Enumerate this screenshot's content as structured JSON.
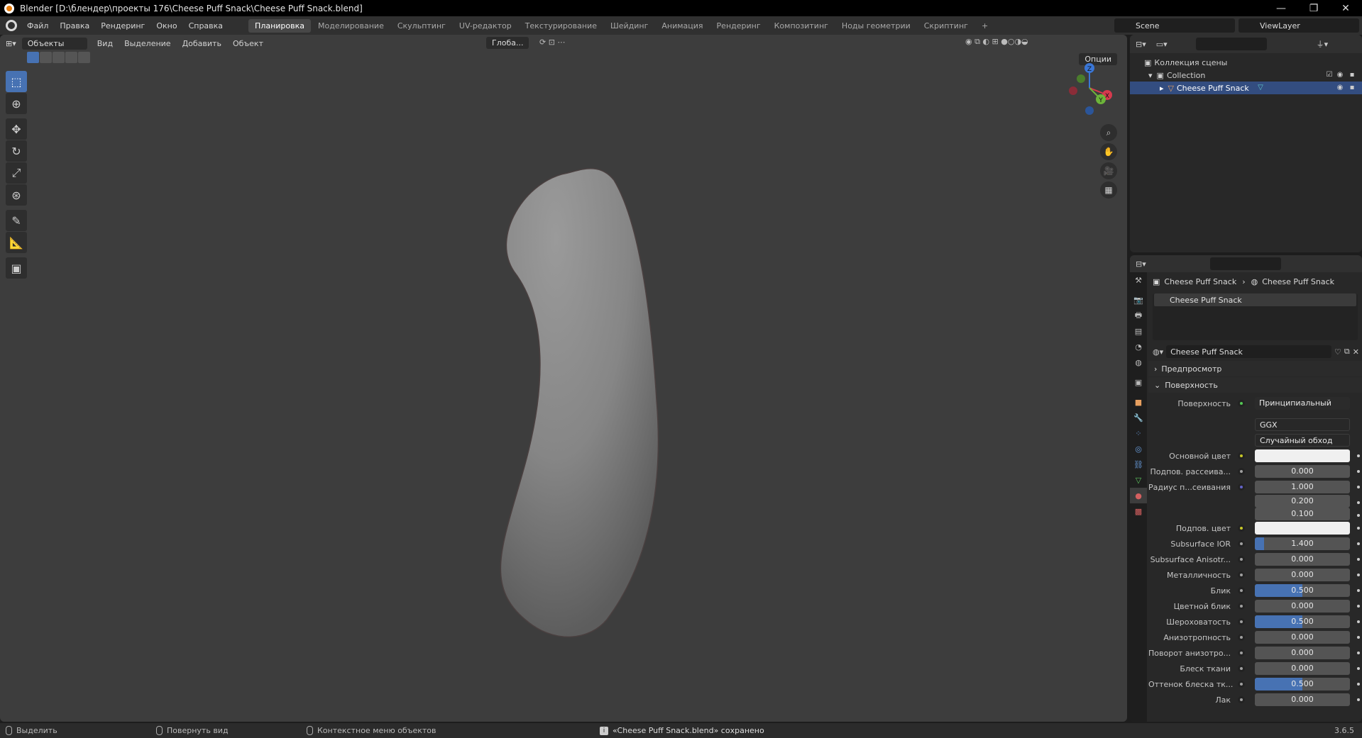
{
  "window": {
    "title": "Blender [D:\\блендер\\проекты 176\\Cheese Puff Snack\\Cheese Puff Snack.blend]",
    "controls": [
      "—",
      "❐",
      "✕"
    ]
  },
  "topbar": {
    "menus": [
      "Файл",
      "Правка",
      "Рендеринг",
      "Окно",
      "Справка"
    ],
    "workspaces": [
      "Планировка",
      "Моделирование",
      "Скульптинг",
      "UV-редактор",
      "Текстурирование",
      "Шейдинг",
      "Анимация",
      "Рендеринг",
      "Композитинг",
      "Ноды геометрии",
      "Скриптинг"
    ],
    "active_workspace": "Планировка",
    "add_tab": "+",
    "scene": "Scene",
    "view_layer": "ViewLayer"
  },
  "viewport": {
    "mode": "Объекты",
    "menus": [
      "Вид",
      "Выделение",
      "Добавить",
      "Объект"
    ],
    "orientation": "Глоба...",
    "options": "Опции",
    "gizmo_axes": [
      "X",
      "Y",
      "Z"
    ],
    "object_color": "#8a8a8a",
    "background": "#3d3d3d"
  },
  "outliner": {
    "rows": [
      {
        "label": "Коллекция сцены",
        "indent": 0
      },
      {
        "label": "Collection",
        "indent": 1
      },
      {
        "label": "Cheese Puff Snack",
        "indent": 2,
        "selected": true
      }
    ]
  },
  "properties": {
    "breadcrumb": [
      "Cheese Puff Snack",
      "Cheese Puff Snack"
    ],
    "slot": "Cheese Puff Snack",
    "material_name": "Cheese Puff Snack",
    "panels": {
      "preview": "Предпросмотр",
      "surface": "Поверхность"
    },
    "surface_label": "Поверхность",
    "surface_shader": "Принципиальный BSDF",
    "distribution": "GGX",
    "subsurface_method": "Случайный обход",
    "rows": [
      {
        "label": "Основной цвет",
        "value": "",
        "type": "color",
        "socket": "yellow"
      },
      {
        "label": "Подпов. рассеива...",
        "value": "0.000",
        "socket": "grey"
      },
      {
        "label": "Радиус п...сеивания",
        "value": "1.000",
        "socket": "purple"
      },
      {
        "label": "",
        "value": "0.200",
        "socket": "none"
      },
      {
        "label": "",
        "value": "0.100",
        "socket": "none"
      },
      {
        "label": "Подпов. цвет",
        "value": "",
        "type": "color",
        "socket": "yellow"
      },
      {
        "label": "Subsurface IOR",
        "value": "1.400",
        "socket": "grey",
        "fill": 0.1
      },
      {
        "label": "Subsurface Anisotr...",
        "value": "0.000",
        "socket": "grey"
      },
      {
        "label": "Металличность",
        "value": "0.000",
        "socket": "grey"
      },
      {
        "label": "Блик",
        "value": "0.500",
        "socket": "grey",
        "fill": 0.5
      },
      {
        "label": "Цветной блик",
        "value": "0.000",
        "socket": "grey"
      },
      {
        "label": "Шероховатость",
        "value": "0.500",
        "socket": "grey",
        "fill": 0.5
      },
      {
        "label": "Анизотропность",
        "value": "0.000",
        "socket": "grey"
      },
      {
        "label": "Поворот анизотро...",
        "value": "0.000",
        "socket": "grey"
      },
      {
        "label": "Блеск ткани",
        "value": "0.000",
        "socket": "grey"
      },
      {
        "label": "Оттенок блеска тк...",
        "value": "0.500",
        "socket": "grey",
        "fill": 0.5
      },
      {
        "label": "Лак",
        "value": "0.000",
        "socket": "grey"
      }
    ]
  },
  "statusbar": {
    "select": "Выделить",
    "rotate": "Повернуть вид",
    "context": "Контекстное меню объектов",
    "message": "«Cheese Puff Snack.blend» сохранено",
    "version": "3.6.5"
  },
  "colors": {
    "accent": "#4772b3",
    "selected_row": "#334d80",
    "orange": "#e87d0d"
  }
}
